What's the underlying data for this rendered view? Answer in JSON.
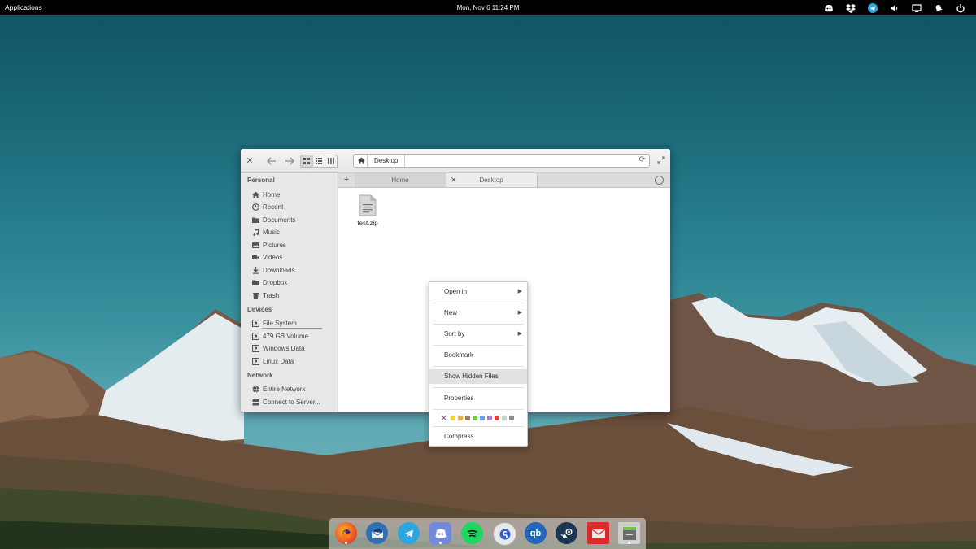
{
  "panel": {
    "applications_label": "Applications",
    "clock": "Mon, Nov  6    11:24 PM",
    "tray_icons": [
      "discord-icon",
      "dropbox-icon",
      "telegram-icon",
      "volume-icon",
      "display-icon",
      "notifications-icon",
      "power-icon"
    ]
  },
  "window": {
    "path": {
      "crumb": "Desktop"
    },
    "tabs": [
      {
        "label": "Home"
      },
      {
        "label": "Desktop"
      }
    ],
    "sidebar": {
      "personal_heading": "Personal",
      "personal_items": [
        "Home",
        "Recent",
        "Documents",
        "Music",
        "Pictures",
        "Videos",
        "Downloads",
        "Dropbox",
        "Trash"
      ],
      "devices_heading": "Devices",
      "devices_items": [
        "File System",
        "479 GB Volume",
        "Windows Data",
        "Linux Data"
      ],
      "network_heading": "Network",
      "network_items": [
        "Entire Network",
        "Connect to Server..."
      ]
    },
    "files": [
      {
        "name": "test.zip",
        "icon": "text-file-icon"
      }
    ]
  },
  "context_menu": {
    "items": [
      "Open in",
      "New",
      "Sort by",
      "Bookmark",
      "Show Hidden Files",
      "Properties",
      "Compress"
    ],
    "highlighted": "Show Hidden Files",
    "tag_colors": [
      "#f0d244",
      "#f2a94b",
      "#a07e5a",
      "#79c647",
      "#6fa2e0",
      "#a67cc8",
      "#e03c3c",
      "#d0d0d0",
      "#8a8a8a"
    ]
  },
  "dock": {
    "apps": [
      "firefox-icon",
      "thunderbird-icon",
      "telegram-icon",
      "discord-icon",
      "spotify-icon",
      "simplenote-icon",
      "qbittorrent-icon",
      "steam-icon",
      "mail-icon",
      "files-icon"
    ]
  },
  "colors": {
    "panel": "#000000",
    "menu_highlight": "#e2e2e2"
  }
}
